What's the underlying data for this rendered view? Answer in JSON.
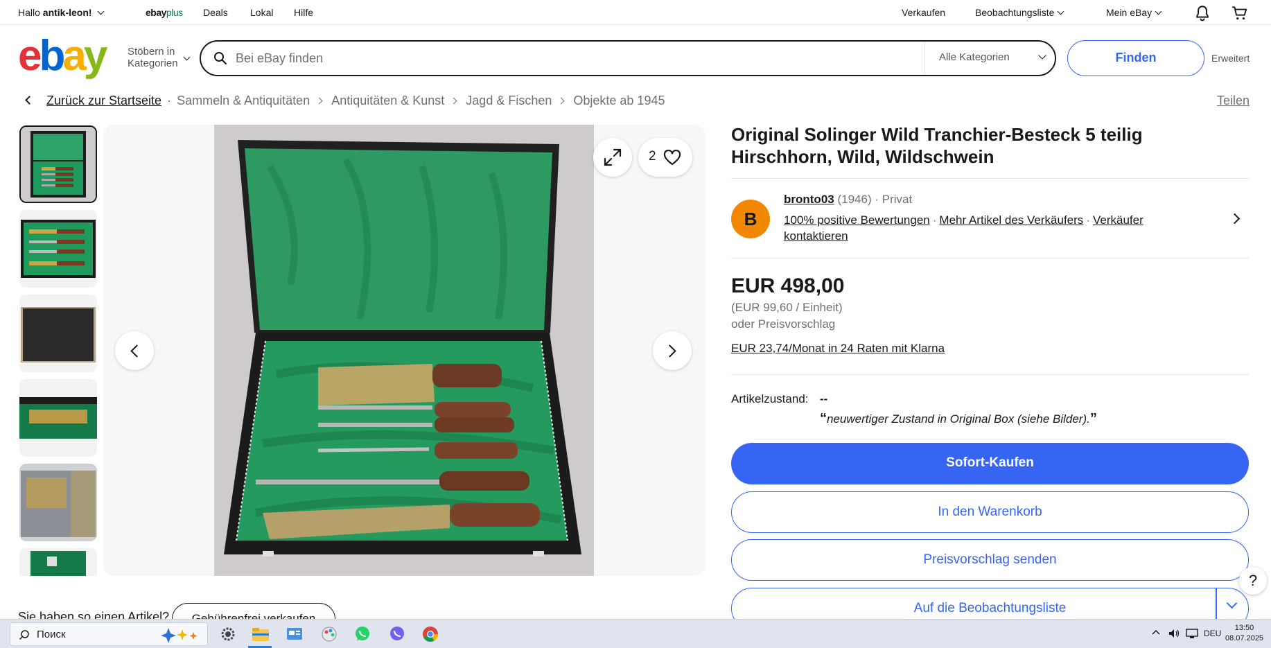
{
  "topbar": {
    "greeting": "Hallo",
    "username": "antik-leon!",
    "ebayplus_a": "ebay",
    "ebayplus_b": "plus",
    "deals": "Deals",
    "local": "Lokal",
    "help": "Hilfe",
    "sell": "Verkaufen",
    "watchlist": "Beobachtungsliste",
    "my_ebay": "Mein eBay"
  },
  "header": {
    "logo": {
      "e": "e",
      "b": "b",
      "a": "a",
      "y": "y"
    },
    "browse_line1": "Stöbern in",
    "browse_line2": "Kategorien",
    "search_placeholder": "Bei eBay finden",
    "category": "Alle Kategorien",
    "find_button": "Finden",
    "advanced": "Erweitert"
  },
  "breadcrumb": {
    "home": "Zurück zur Startseite",
    "items": [
      "Sammeln & Antiquitäten",
      "Antiquitäten & Kunst",
      "Jagd & Fischen",
      "Objekte ab 1945"
    ],
    "share": "Teilen"
  },
  "gallery": {
    "favorite_count": "2"
  },
  "listing": {
    "title": "Original Solinger Wild Tranchier-Besteck 5 teilig Hirschhorn, Wild, Wildschwein",
    "seller": {
      "avatar_letter": "B",
      "name": "bronto03",
      "score": "(1946)",
      "sep": "·",
      "type": "Privat",
      "positive": "100% positive Bewertungen",
      "more_items": "Mehr Artikel des Verkäufers",
      "contact": "Verkäufer kontaktieren"
    },
    "price": "EUR 498,00",
    "unit_price": "(EUR 99,60 / Einheit)",
    "offer": "oder Preisvorschlag",
    "klarna": "EUR 23,74/Monat in 24 Raten mit Klarna",
    "condition_label": "Artikelzustand:",
    "condition_value": "--",
    "condition_note": "neuwertiger Zustand in Original Box (siehe Bilder).",
    "quote_open": "“",
    "quote_close": "”",
    "buy_now": "Sofort-Kaufen",
    "add_to_cart": "In den Warenkorb",
    "make_offer": "Preisvorschlag senden",
    "add_to_watchlist": "Auf die Beobachtungsliste"
  },
  "bottom": {
    "text": "Sie haben so einen Artikel?",
    "button": "Gebührenfrei verkaufen"
  },
  "help_symbol": "?",
  "taskbar": {
    "search_label": "Поиск",
    "lang": "DEU",
    "time": "13:50",
    "date": "08.07.2025"
  },
  "colors": {
    "brand_blue": "#3665f3",
    "avatar_orange": "#f18800",
    "logo_red": "#e53238",
    "logo_blue": "#0064d2",
    "logo_yellow": "#f5af02",
    "logo_green": "#86b817"
  }
}
